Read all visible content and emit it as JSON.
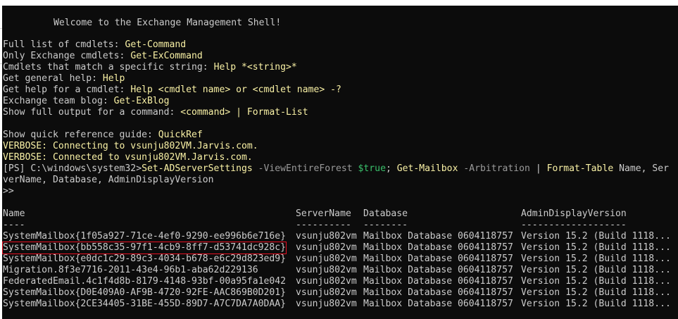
{
  "welcome": "Welcome to the Exchange Management Shell!",
  "help": [
    {
      "prefix": "Full list of cmdlets: ",
      "cmd": "Get-Command"
    },
    {
      "prefix": "Only Exchange cmdlets: ",
      "cmd": "Get-ExCommand"
    },
    {
      "prefix": "Cmdlets that match a specific string: ",
      "cmd": "Help *<string>*"
    },
    {
      "prefix": "Get general help: ",
      "cmd": "Help"
    },
    {
      "prefix": "Get help for a cmdlet: ",
      "cmd": "Help <cmdlet name> or <cmdlet name> -?"
    },
    {
      "prefix": "Exchange team blog: ",
      "cmd": "Get-ExBlog"
    },
    {
      "prefix": "Show full output for a command: ",
      "cmd": "<command> | Format-List"
    }
  ],
  "quickref": {
    "prefix": "Show quick reference guide: ",
    "cmd": "QuickRef"
  },
  "verbose": [
    "VERBOSE: Connecting to vsunju802VM.Jarvis.com.",
    "VERBOSE: Connected to vsunju802VM.Jarvis.com."
  ],
  "prompt": {
    "ps": "[PS] C:\\windows\\system32>",
    "cmd1": "Set-ADServerSettings",
    "param1": " -ViewEntireForest ",
    "val1": "$true",
    "sep": "; ",
    "cmd2": "Get-Mailbox",
    "param2": " -Arbitration ",
    "pipe": "| ",
    "cmd3": "Format-Table",
    "args": " Name, Ser",
    "wrap": "verName, Database, AdminDisplayVersion",
    "continuation": ">>"
  },
  "table": {
    "headers": [
      "Name",
      "ServerName",
      "Database",
      "AdminDisplayVersion"
    ],
    "underline": [
      "----",
      "----------",
      "--------",
      "-------------------"
    ],
    "rows": [
      [
        "SystemMailbox{1f05a927-71ce-4ef0-9290-ee996b6e716e}",
        "vsunju802vm",
        "Mailbox Database 0604118757",
        "Version 15.2 (Build 1118..."
      ],
      [
        "SystemMailbox{bb558c35-97f1-4cb9-8ff7-d53741dc928c}",
        "vsunju802vm",
        "Mailbox Database 0604118757",
        "Version 15.2 (Build 1118..."
      ],
      [
        "SystemMailbox{e0dc1c29-89c3-4034-b678-e6c29d823ed9}",
        "vsunju802vm",
        "Mailbox Database 0604118757",
        "Version 15.2 (Build 1118..."
      ],
      [
        "Migration.8f3e7716-2011-43e4-96b1-aba62d229136",
        "vsunju802vm",
        "Mailbox Database 0604118757",
        "Version 15.2 (Build 1118..."
      ],
      [
        "FederatedEmail.4c1f4d8b-8179-4148-93bf-00a95fa1e042",
        "vsunju802vm",
        "Mailbox Database 0604118757",
        "Version 15.2 (Build 1118..."
      ],
      [
        "SystemMailbox{D0E409A0-AF9B-4720-92FE-AAC869B0D201}",
        "vsunju802vm",
        "Mailbox Database 0604118757",
        "Version 15.2 (Build 1118..."
      ],
      [
        "SystemMailbox{2CE34405-31BE-455D-89D7-A7C7DA7A0DAA}",
        "vsunju802vm",
        "Mailbox Database 0604118757",
        "Version 15.2 (Build 1118..."
      ]
    ]
  },
  "colors": {
    "background": "#0c0c0c",
    "text": "#cccccc",
    "command": "#f9f1a5",
    "parameter": "#9a9a9a",
    "variable": "#3ac06b",
    "highlight": "#e81123"
  }
}
